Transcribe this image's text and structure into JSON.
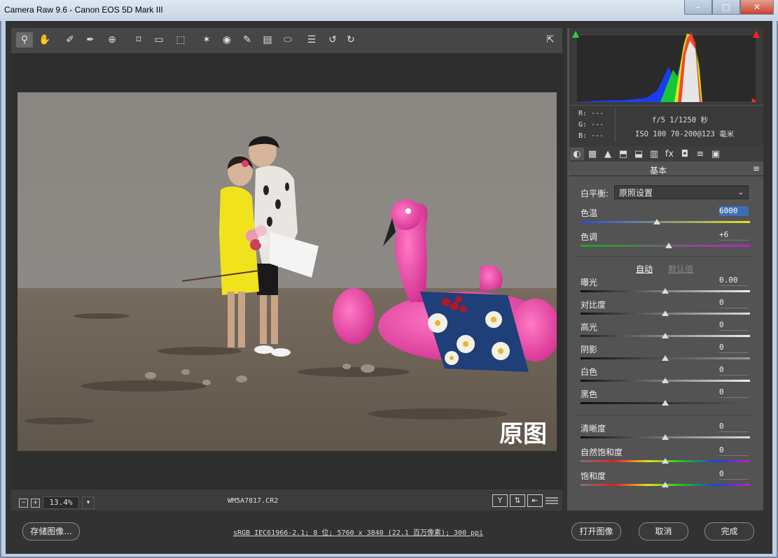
{
  "window": {
    "title": "Camera Raw 9.6 -  Canon EOS 5D Mark III"
  },
  "window_controls": {
    "minimize": "–",
    "maximize": "□",
    "close": "✕"
  },
  "toolbar": {
    "tools": [
      {
        "icon": "zoom-icon",
        "glyph": "⚲",
        "active": true
      },
      {
        "icon": "hand-icon",
        "glyph": "✋"
      },
      {
        "icon": "white-balance-icon",
        "glyph": "✐"
      },
      {
        "icon": "color-sampler-icon",
        "glyph": "✒"
      },
      {
        "icon": "target-adjustment-icon",
        "glyph": "⊕"
      },
      {
        "icon": "crop-icon",
        "glyph": "⌑"
      },
      {
        "icon": "straighten-icon",
        "glyph": "▭"
      },
      {
        "icon": "transform-icon",
        "glyph": "⬚"
      },
      {
        "icon": "spot-removal-icon",
        "glyph": "✶"
      },
      {
        "icon": "red-eye-icon",
        "glyph": "◉"
      },
      {
        "icon": "adjustment-brush-icon",
        "glyph": "✎"
      },
      {
        "icon": "graduated-filter-icon",
        "glyph": "▤"
      },
      {
        "icon": "radial-filter-icon",
        "glyph": "⬭"
      },
      {
        "icon": "preferences-icon",
        "glyph": "☰"
      },
      {
        "icon": "rotate-left-icon",
        "glyph": "↺"
      },
      {
        "icon": "rotate-right-icon",
        "glyph": "↻"
      }
    ],
    "fullscreen_icon": "⇱"
  },
  "preview": {
    "overlay_text": "原图"
  },
  "status": {
    "zoom_minus": "−",
    "zoom_plus": "+",
    "zoom": "13.4%",
    "zoom_dropdown": "▾",
    "filename": "WM5A7817.CR2",
    "view_buttons": [
      "Y",
      "⇅",
      "⇤"
    ]
  },
  "histogram": {
    "colors": {
      "shadow_clip": "#2ecc40",
      "highlight_clip": "#ff2020"
    }
  },
  "rgb": {
    "r": "R:  ---",
    "g": "G:  ---",
    "b": "B:  ---"
  },
  "exif": {
    "aperture_shutter": "f/5  1/1250 秒",
    "iso_lens": "ISO 100  70-200@123 毫米"
  },
  "tabs": [
    "◐",
    "▦",
    "▲",
    "⬒",
    "⬓",
    "▥",
    "fx",
    "◘",
    "≡",
    "▣"
  ],
  "panel": {
    "name": "基本",
    "menu_icon": "≡",
    "white_balance_label": "白平衡:",
    "white_balance_value": "原照设置",
    "auto": "自动",
    "default": "默认值",
    "sliders": [
      {
        "key": "temp",
        "label": "色温",
        "value": "6000",
        "level": 0.45
      },
      {
        "key": "tint",
        "label": "色调",
        "value": "+6",
        "level": 0.52
      },
      {
        "key": "exposure",
        "label": "曝光",
        "value": "0.00",
        "level": 0.5
      },
      {
        "key": "contrast",
        "label": "对比度",
        "value": "0",
        "level": 0.5
      },
      {
        "key": "highlights",
        "label": "高光",
        "value": "0",
        "level": 0.5
      },
      {
        "key": "shadows",
        "label": "阴影",
        "value": "0",
        "level": 0.5
      },
      {
        "key": "whites",
        "label": "白色",
        "value": "0",
        "level": 0.5
      },
      {
        "key": "blacks",
        "label": "黑色",
        "value": "0",
        "level": 0.5
      },
      {
        "key": "clarity",
        "label": "清晰度",
        "value": "0",
        "level": 0.5
      },
      {
        "key": "vibrance",
        "label": "自然饱和度",
        "value": "0",
        "level": 0.5
      },
      {
        "key": "saturation",
        "label": "饱和度",
        "value": "0",
        "level": 0.5
      }
    ]
  },
  "footer": {
    "save": "存储图像...",
    "workflow": "sRGB IEC61966-2.1; 8 位; 5760 x 3840 (22.1 百万像素); 300 ppi",
    "open": "打开图像",
    "cancel": "取消",
    "done": "完成"
  }
}
